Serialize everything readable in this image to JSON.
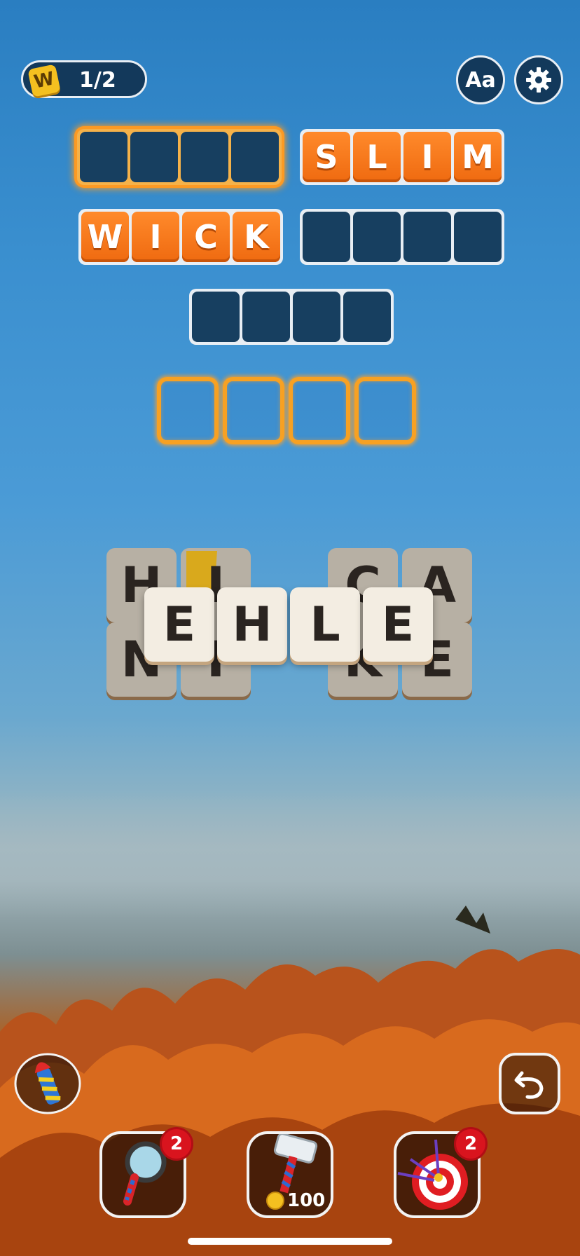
{
  "header": {
    "word_icon_letter": "W",
    "progress": "1/2",
    "font_button_label": "Aa"
  },
  "puzzle": {
    "row1": {
      "left": [
        "",
        "",
        "",
        ""
      ],
      "right": [
        "S",
        "L",
        "I",
        "M"
      ]
    },
    "row2": {
      "left": [
        "W",
        "I",
        "C",
        "K"
      ],
      "right": [
        "",
        "",
        "",
        ""
      ]
    },
    "row3": [
      "",
      "",
      "",
      ""
    ]
  },
  "input_slots": [
    "",
    "",
    "",
    ""
  ],
  "stack_left": [
    "H",
    "I",
    "N",
    "I"
  ],
  "stack_right": [
    "C",
    "A",
    "K",
    "E"
  ],
  "top_tiles": [
    "E",
    "H",
    "L",
    "E"
  ],
  "tools": {
    "magnifier_count": "2",
    "hammer_cost": "100",
    "darts_count": "2"
  },
  "colors": {
    "filled_tile": "#ef6a10",
    "empty_tile": "#173f60",
    "highlight": "#f7a123"
  }
}
